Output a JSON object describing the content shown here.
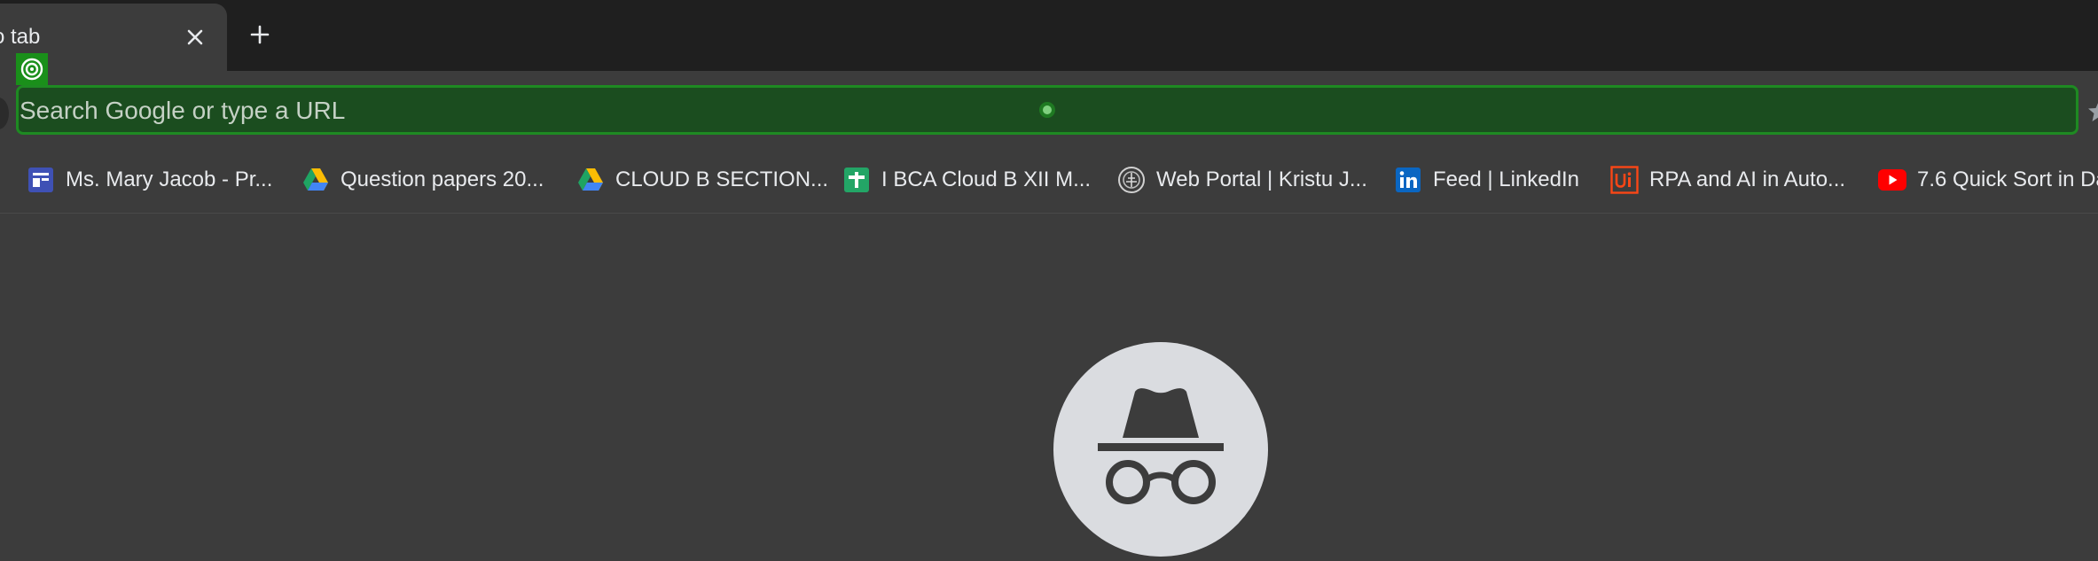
{
  "tab": {
    "title": "o tab",
    "close_glyph": "✕",
    "new_tab_glyph": "+"
  },
  "omnibox": {
    "placeholder": "Search Google or type a URL"
  },
  "bookmarks": [
    {
      "label": "Ms. Mary Jacob - Pr...",
      "icon": "forms-icon",
      "color": "#3f51b5"
    },
    {
      "label": "Question papers 20...",
      "icon": "google-drive-icon",
      "color": "#1fa463"
    },
    {
      "label": "CLOUD B SECTION...",
      "icon": "google-drive-icon",
      "color": "#1fa463"
    },
    {
      "label": "I BCA Cloud B XII M...",
      "icon": "google-sheets-icon",
      "color": "#23a566"
    },
    {
      "label": "Web Portal | Kristu J...",
      "icon": "kristu-jayanti-logo-icon",
      "color": "#cfcfcf"
    },
    {
      "label": "Feed | LinkedIn",
      "icon": "linkedin-icon",
      "color": "#0a66c2"
    },
    {
      "label": "RPA and AI in Auto...",
      "icon": "uipath-icon",
      "color": "#fa4616"
    },
    {
      "label": "7.6 Quick Sort in Da",
      "icon": "youtube-icon",
      "color": "#ff0000"
    }
  ],
  "colors": {
    "tabstrip": "#1f1f1f",
    "surface": "#3c3c3c",
    "omnibox_highlight": "#1b4d1f",
    "omnibox_border": "#1e8a22"
  },
  "content": {
    "icon": "incognito-icon"
  }
}
